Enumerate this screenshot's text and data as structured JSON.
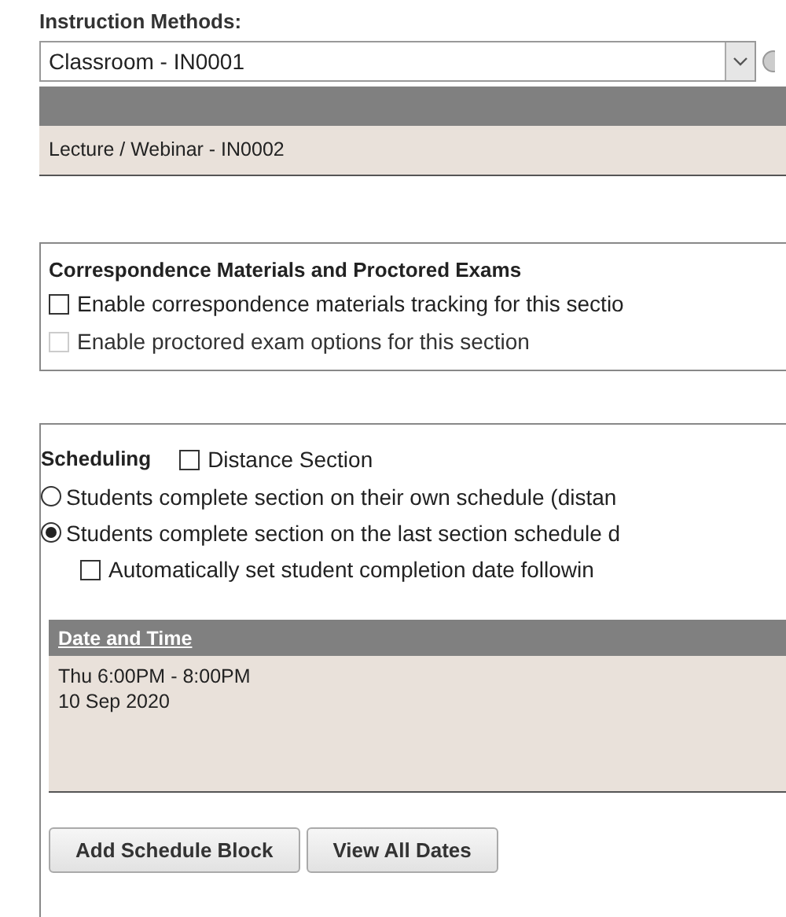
{
  "instruction_methods": {
    "label": "Instruction Methods:",
    "value": "Classroom - IN0001",
    "expanded": true,
    "options": [
      {
        "label": "Lecture / Webinar - IN0002"
      }
    ]
  },
  "correspondence": {
    "title": "Correspondence Materials and Proctored Exams",
    "options": [
      {
        "label": "Enable correspondence materials tracking for this sectio",
        "checked": false,
        "disabled": false
      },
      {
        "label": "Enable proctored exam options for this section",
        "checked": false,
        "disabled": true
      }
    ]
  },
  "scheduling": {
    "title": "Scheduling",
    "distance": {
      "label": "Distance Section",
      "checked": false
    },
    "modes": [
      {
        "label": "Students complete section on their own schedule (distan",
        "selected": false
      },
      {
        "label": "Students complete section on the last section schedule d",
        "selected": true
      }
    ],
    "auto_completion": {
      "label": "Automatically set student completion date followin",
      "checked": false
    },
    "table": {
      "column": "Date and Time",
      "rows": [
        {
          "lines": [
            "Thu 6:00PM - 8:00PM",
            "10 Sep 2020"
          ]
        }
      ]
    },
    "buttons": [
      "Add Schedule Block",
      "View All Dates"
    ]
  }
}
